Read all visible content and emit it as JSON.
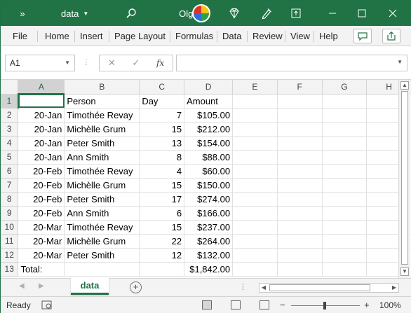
{
  "titlebar": {
    "doc_name": "data",
    "user": "Olga S",
    "icons": [
      "chevrons-icon",
      "search-icon",
      "diamond-icon",
      "pen-icon",
      "restore-icon",
      "minimize-icon",
      "maximize-icon",
      "close-icon"
    ]
  },
  "ribbon": {
    "tabs": [
      "File",
      "Home",
      "Insert",
      "Page Layout",
      "Formulas",
      "Data",
      "Review",
      "View",
      "Help"
    ],
    "accent_color": "#217346"
  },
  "formula_bar": {
    "name_box": "A1",
    "fx_label": "fx",
    "formula": ""
  },
  "sheet": {
    "columns": [
      "A",
      "B",
      "C",
      "D",
      "E",
      "F",
      "G",
      "H"
    ],
    "rows": [
      {
        "n": "1",
        "cells": [
          "",
          "Person",
          "Day",
          "Amount",
          "",
          "",
          "",
          ""
        ]
      },
      {
        "n": "2",
        "cells": [
          "20-Jan",
          "Timothée Revay",
          "7",
          "$105.00",
          "",
          "",
          "",
          ""
        ]
      },
      {
        "n": "3",
        "cells": [
          "20-Jan",
          "Michèlle Grum",
          "15",
          "$212.00",
          "",
          "",
          "",
          ""
        ]
      },
      {
        "n": "4",
        "cells": [
          "20-Jan",
          "Peter Smith",
          "13",
          "$154.00",
          "",
          "",
          "",
          ""
        ]
      },
      {
        "n": "5",
        "cells": [
          "20-Jan",
          "Ann Smith",
          "8",
          "$88.00",
          "",
          "",
          "",
          ""
        ]
      },
      {
        "n": "6",
        "cells": [
          "20-Feb",
          "Timothée Revay",
          "4",
          "$60.00",
          "",
          "",
          "",
          ""
        ]
      },
      {
        "n": "7",
        "cells": [
          "20-Feb",
          "Michèlle Grum",
          "15",
          "$150.00",
          "",
          "",
          "",
          ""
        ]
      },
      {
        "n": "8",
        "cells": [
          "20-Feb",
          "Peter Smith",
          "17",
          "$274.00",
          "",
          "",
          "",
          ""
        ]
      },
      {
        "n": "9",
        "cells": [
          "20-Feb",
          "Ann Smith",
          "6",
          "$166.00",
          "",
          "",
          "",
          ""
        ]
      },
      {
        "n": "10",
        "cells": [
          "20-Mar",
          "Timothée Revay",
          "15",
          "$237.00",
          "",
          "",
          "",
          ""
        ]
      },
      {
        "n": "11",
        "cells": [
          "20-Mar",
          "Michèlle Grum",
          "22",
          "$264.00",
          "",
          "",
          "",
          ""
        ]
      },
      {
        "n": "12",
        "cells": [
          "20-Mar",
          "Peter Smith",
          "12",
          "$132.00",
          "",
          "",
          "",
          ""
        ]
      },
      {
        "n": "13",
        "cells": [
          "Total:",
          "",
          "",
          "$1,842.00",
          "",
          "",
          "",
          ""
        ]
      }
    ]
  },
  "sheet_tabs": {
    "active": "data",
    "add_label": "+"
  },
  "status": {
    "ready": "Ready",
    "zoom": "100%",
    "zoom_minus": "−",
    "zoom_plus": "+"
  }
}
